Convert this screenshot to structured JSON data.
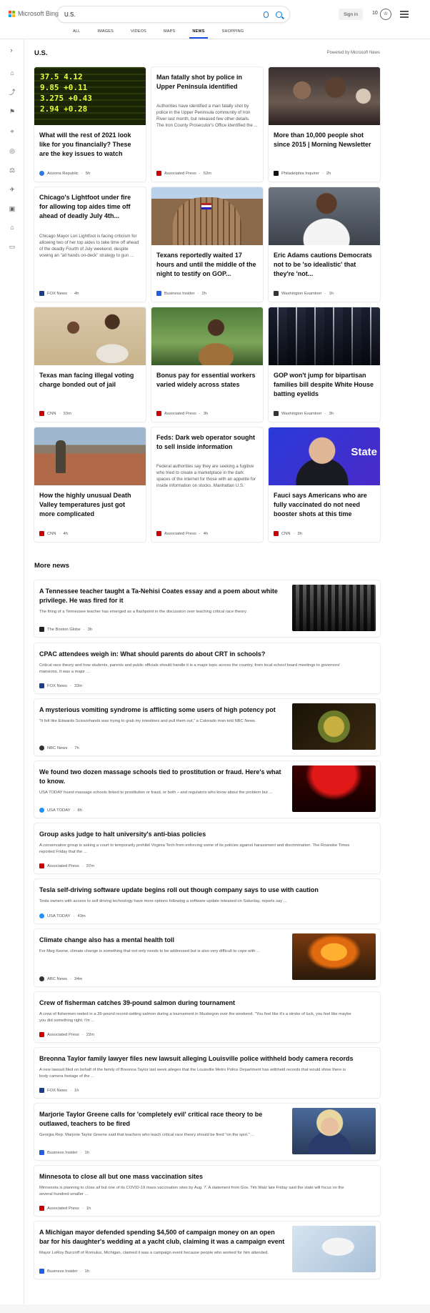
{
  "brand": {
    "name": "Microsoft Bing"
  },
  "search": {
    "query": "U.S."
  },
  "header": {
    "sign_in": "Sign in",
    "points": "10"
  },
  "tabs": [
    "ALL",
    "IMAGES",
    "VIDEOS",
    "MAPS",
    "NEWS",
    "SHOPPING"
  ],
  "active_tab": "NEWS",
  "section": {
    "title": "U.S.",
    "powered_by": "Powered by Microsoft News"
  },
  "cards": [
    {
      "title": "What will the rest of 2021 look like for you financially? These are the key issues to watch",
      "snippet": "",
      "source": "Arizona Republic",
      "time": "5h"
    },
    {
      "title": "Man fatally shot by police in Upper Peninsula identified",
      "snippet": "Authorities have identified a man fatally shot by police in the Upper Peninsula community of Iron River last month, but released few other details. The Iron County Prosecutor's Office identified the ...",
      "source": "Associated Press",
      "time": "52m"
    },
    {
      "title": "More than 10,000 people shot since 2015 | Morning Newsletter",
      "snippet": "",
      "source": "Philadelphia Inquirer",
      "time": "2h"
    },
    {
      "title": "Chicago's Lightfoot under fire for allowing top aides time off ahead of deadly July 4th...",
      "snippet": "Chicago Mayor Lori Lightfoot is facing criticism for allowing two of her top aides to take time off ahead of the deadly Fourth of July weekend, despite vowing an \"all hands on-deck\" strategy to gun ...",
      "source": "FOX News",
      "time": "4h"
    },
    {
      "title": "Texans reportedly waited 17 hours and until the middle of the night to testify on GOP...",
      "snippet": "",
      "source": "Business Insider",
      "time": "2h"
    },
    {
      "title": "Eric Adams cautions Democrats not to be 'so idealistic' that they're 'not...",
      "snippet": "",
      "source": "Washington Examiner",
      "time": "1h"
    },
    {
      "title": "Texas man facing illegal voting charge bonded out of jail",
      "snippet": "",
      "source": "CNN",
      "time": "33m"
    },
    {
      "title": "Bonus pay for essential workers varied widely across states",
      "snippet": "",
      "source": "Associated Press",
      "time": "3h"
    },
    {
      "title": "GOP won't jump for bipartisan families bill despite White House batting eyelids",
      "snippet": "",
      "source": "Washington Examiner",
      "time": "3h"
    },
    {
      "title": "How the highly unusual Death Valley temperatures just got more complicated",
      "snippet": "",
      "source": "CNN",
      "time": "4h"
    },
    {
      "title": "Feds: Dark web operator sought to sell inside information",
      "snippet": "Federal authorities say they are seeking a fugitive who tried to create a marketplace in the dark spaces of the internet for those with an appetite for inside information on stocks. Manhattan U.S.",
      "source": "Associated Press",
      "time": "4h"
    },
    {
      "title": "Fauci says Americans who are fully vaccinated do not need booster shots at this time",
      "snippet": "",
      "source": "CNN",
      "time": "3h"
    }
  ],
  "more_news": {
    "title": "More news",
    "items": [
      {
        "title": "A Tennessee teacher taught a Ta-Nehisi Coates essay and a poem about white privilege. He was fired for it",
        "snippet": "The firing of a Tennessee teacher has emerged as a flashpoint in the discussion over teaching critical race theory.",
        "source": "The Boston Globe",
        "time": "3h"
      },
      {
        "title": "CPAC attendees weigh in: What should parents do about CRT in schools?",
        "snippet": "Critical race theory and how students, parents and public officials should handle it is a major topic across the country, from local school board meetings to governors' mansions.  It was a major ...",
        "source": "FOX News",
        "time": "33m"
      },
      {
        "title": "A mysterious vomiting syndrome is afflicting some users of high potency pot",
        "snippet": "\"It felt like Edwards Scissorhands was trying to grab my intestines and pull them out,\" a Colorado man told NBC News.",
        "source": "NBC News",
        "time": "7h"
      },
      {
        "title": "We found two dozen massage schools tied to prostitution or fraud. Here's what to know.",
        "snippet": "USA TODAY found massage schools linked to prostitution or fraud, or both – and regulators who know about the problem but ...",
        "source": "USA TODAY",
        "time": "8h"
      },
      {
        "title": "Group asks judge to halt university's anti-bias policies",
        "snippet": "A conservative group is asking a court to temporarily prohibit Virginia Tech from enforcing some of its policies against harassment and discrimination. The Roanoke Times reported Friday that the ...",
        "source": "Associated Press",
        "time": "37m"
      },
      {
        "title": "Tesla self-driving software update begins roll out though company says to use with caution",
        "snippet": "Tesla owners with access to self driving technology have more options following a software update released on Saturday, reports say ...",
        "source": "USA TODAY",
        "time": "43m"
      },
      {
        "title": "Climate change also has a mental health toll",
        "snippet": "For Meg Keene, climate change is something that not only needs to be addressed but is also very difficult to cope with ...",
        "source": "ABC News",
        "time": "34m"
      },
      {
        "title": "Crew of fisherman catches 39-pound salmon during tournament",
        "snippet": "A crew of fishermen reeled in a 39-pound record-setting salmon during a tournament in Muskegon over the weekend. \"You feel like it's a stroke of luck, you feel like maybe you did something right. I'm ...",
        "source": "Associated Press",
        "time": "22m"
      },
      {
        "title": "Breonna Taylor family lawyer files new lawsuit alleging Louisville police withheld body camera records",
        "snippet": "A new lawsuit filed on behalf of the family of Breonna Taylor last week alleges that the Louisville Metro Police Department has withheld records that would show there is body camera footage of the ...",
        "source": "FOX News",
        "time": "1h"
      },
      {
        "title": "Marjorie Taylor Greene calls for 'completely evil' critical race theory to be outlawed, teachers to be fired",
        "snippet": "Georgia Rep. Marjorie Taylor Greene said that teachers who teach critical race theory should be fired \"on the spot.\" ...",
        "source": "Business Insider",
        "time": "1h"
      },
      {
        "title": "Minnesota to close all but one mass vaccination sites",
        "snippet": "Minnesota is planning to close all but one of its COVID-19 mass vaccination sites by Aug. 7. A statement from Gov. Tim Walz late Friday said the state will focus on the several hundred smaller ...",
        "source": "Associated Press",
        "time": "1h"
      },
      {
        "title": "A Michigan mayor defended spending $4,500 of campaign money on an open bar for his daughter's wedding at a yacht club, claiming it was a campaign event",
        "snippet": "Mayor LeRoy Burcroff of Romulus, Michigan, claimed it was a campaign event because people who worked for him attended.",
        "source": "Business Insider",
        "time": "1h"
      }
    ]
  },
  "colors": {
    "accent": "#174ae4",
    "brand_blue": "#0b7ad9"
  }
}
